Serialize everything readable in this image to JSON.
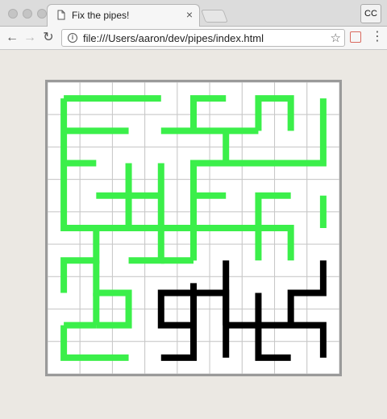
{
  "window": {
    "tab_title": "Fix the pipes!",
    "tab_close": "×",
    "profile_label": "CC"
  },
  "toolbar": {
    "back": "←",
    "forward": "→",
    "reload": "↻",
    "url": "file:///Users/aaron/dev/pipes/index.html",
    "bookmark_icon": "☆",
    "menu_icon": "⋮"
  },
  "game": {
    "grid_size": 9,
    "colors": {
      "connected": "#3bef4a",
      "disconnected": "#000000",
      "grid": "#c8c8c8"
    },
    "green_paths": [
      [
        [
          0.5,
          0.5
        ],
        [
          3.5,
          0.5
        ]
      ],
      [
        [
          0.5,
          0.5
        ],
        [
          0.5,
          4.5
        ],
        [
          1.5,
          4.5
        ],
        [
          1.5,
          5.5
        ],
        [
          0.5,
          5.5
        ],
        [
          0.5,
          6.5
        ]
      ],
      [
        [
          0.5,
          1.5
        ],
        [
          2.5,
          1.5
        ]
      ],
      [
        [
          0.5,
          2.5
        ],
        [
          1.5,
          2.5
        ]
      ],
      [
        [
          1.5,
          4.5
        ],
        [
          2.5,
          4.5
        ],
        [
          2.5,
          3.5
        ],
        [
          1.5,
          3.5
        ]
      ],
      [
        [
          1.5,
          5.5
        ],
        [
          1.5,
          6.5
        ],
        [
          2.5,
          6.5
        ],
        [
          2.5,
          7.5
        ],
        [
          1.5,
          7.5
        ]
      ],
      [
        [
          1.5,
          6.5
        ],
        [
          1.5,
          7.5
        ]
      ],
      [
        [
          0.5,
          7.5
        ],
        [
          0.5,
          8.5
        ],
        [
          2.5,
          8.5
        ]
      ],
      [
        [
          0.5,
          7.5
        ],
        [
          1.5,
          7.5
        ]
      ],
      [
        [
          2.5,
          2.5
        ],
        [
          2.5,
          3.5
        ]
      ],
      [
        [
          2.5,
          3.5
        ],
        [
          3.5,
          3.5
        ]
      ],
      [
        [
          3.5,
          2.5
        ],
        [
          3.5,
          5.5
        ],
        [
          2.5,
          5.5
        ]
      ],
      [
        [
          2.5,
          4.5
        ],
        [
          7.5,
          4.5
        ],
        [
          7.5,
          5.5
        ]
      ],
      [
        [
          3.5,
          1.5
        ],
        [
          6.5,
          1.5
        ]
      ],
      [
        [
          4.5,
          1.5
        ],
        [
          4.5,
          0.5
        ],
        [
          5.5,
          0.5
        ]
      ],
      [
        [
          5.5,
          1.5
        ],
        [
          5.5,
          2.5
        ],
        [
          4.5,
          2.5
        ],
        [
          4.5,
          5.5
        ],
        [
          4.5,
          5.5
        ]
      ],
      [
        [
          4.5,
          3.5
        ],
        [
          5.5,
          3.5
        ]
      ],
      [
        [
          4.5,
          5.5
        ],
        [
          3.5,
          5.5
        ]
      ],
      [
        [
          4.5,
          5.5
        ],
        [
          4.5,
          4.5
        ]
      ],
      [
        [
          6.5,
          1.5
        ],
        [
          6.5,
          0.5
        ],
        [
          7.5,
          0.5
        ],
        [
          7.5,
          1.5
        ]
      ],
      [
        [
          5.5,
          2.5
        ],
        [
          8.5,
          2.5
        ],
        [
          8.5,
          0.5
        ]
      ],
      [
        [
          6.5,
          4.5
        ],
        [
          6.5,
          5.5
        ]
      ],
      [
        [
          6.5,
          4.5
        ],
        [
          6.5,
          3.5
        ],
        [
          7.5,
          3.5
        ]
      ],
      [
        [
          8.5,
          3.5
        ],
        [
          8.5,
          4.5
        ]
      ]
    ],
    "black_paths": [
      [
        [
          5.5,
          5.5
        ],
        [
          5.5,
          8.5
        ]
      ],
      [
        [
          5.5,
          7.5
        ],
        [
          8.5,
          7.5
        ],
        [
          8.5,
          8.5
        ]
      ],
      [
        [
          4.5,
          6.5
        ],
        [
          4.5,
          7.5
        ],
        [
          3.5,
          7.5
        ],
        [
          3.5,
          6.5
        ],
        [
          4.5,
          6.5
        ],
        [
          4.5,
          6.2
        ]
      ],
      [
        [
          4.5,
          6.5
        ],
        [
          5.5,
          6.5
        ],
        [
          5.5,
          7.5
        ]
      ],
      [
        [
          3.5,
          8.5
        ],
        [
          4.5,
          8.5
        ],
        [
          4.5,
          7.5
        ]
      ],
      [
        [
          6.5,
          6.5
        ],
        [
          6.5,
          8.5
        ],
        [
          7.5,
          8.5
        ]
      ],
      [
        [
          7.5,
          7.5
        ],
        [
          7.5,
          6.5
        ],
        [
          8.5,
          6.5
        ],
        [
          8.5,
          5.5
        ]
      ]
    ]
  }
}
